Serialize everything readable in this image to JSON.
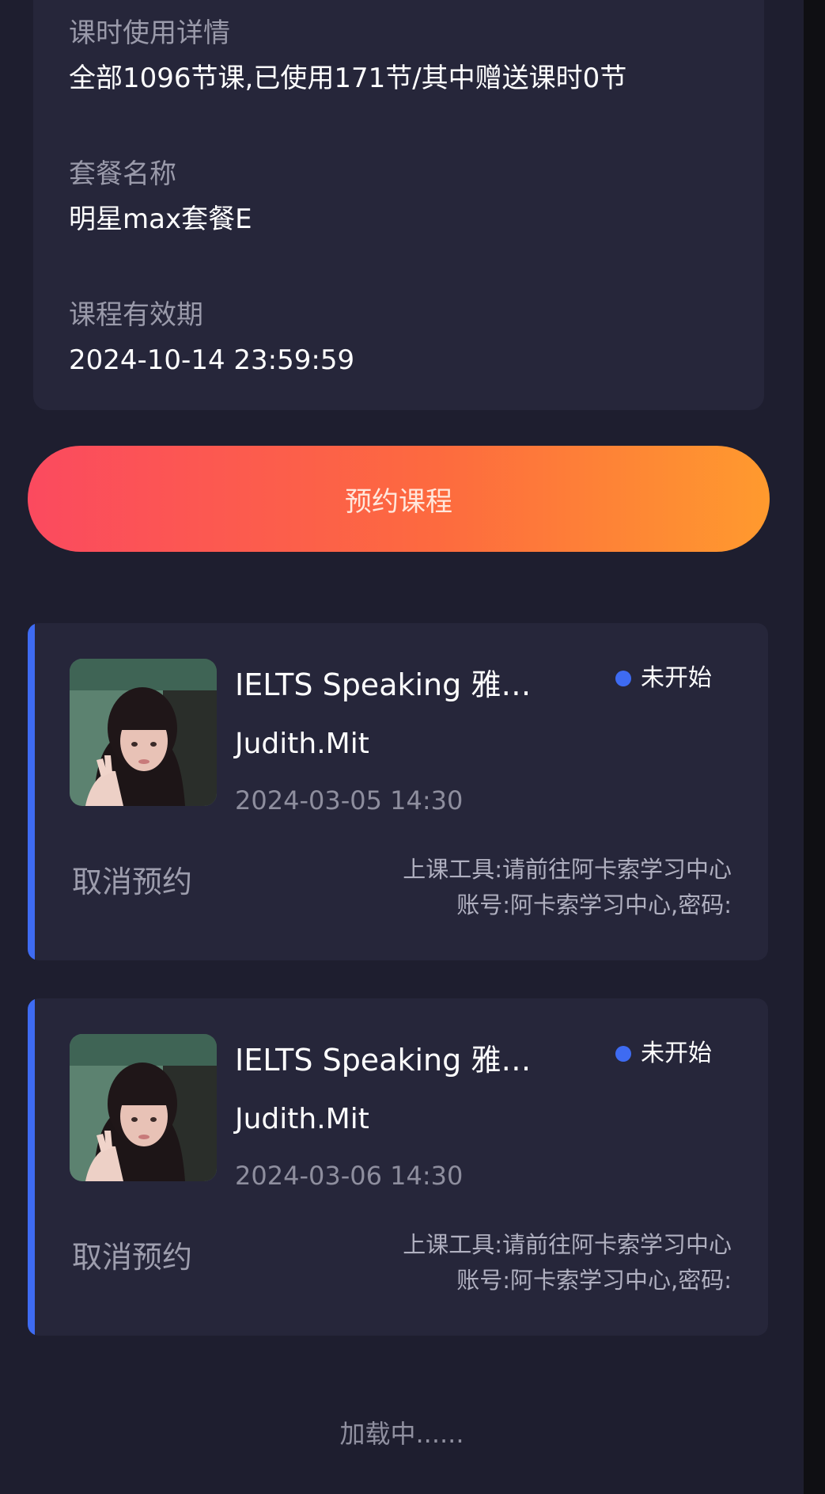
{
  "info": {
    "usage_label": "课时使用详情",
    "usage_value": "全部1096节课,已使用171节/其中赠送课时0节",
    "package_label": "套餐名称",
    "package_value": "明星max套餐E",
    "validity_label": "课程有效期",
    "validity_value": "2024-10-14 23:59:59"
  },
  "book_button": "预约课程",
  "lessons": [
    {
      "title": "IELTS Speaking 雅…",
      "status": "未开始",
      "teacher": "Judith.Mit",
      "time": "2024-03-05 14:30",
      "cancel": "取消预约",
      "tool": "上课工具:请前往阿卡索学习中心",
      "account": "账号:阿卡索学习中心,密码:"
    },
    {
      "title": "IELTS Speaking 雅…",
      "status": "未开始",
      "teacher": "Judith.Mit",
      "time": "2024-03-06 14:30",
      "cancel": "取消预约",
      "tool": "上课工具:请前往阿卡索学习中心",
      "account": "账号:阿卡索学习中心,密码:"
    }
  ],
  "loading_text": "加载中......",
  "colors": {
    "background": "#1e1e2f",
    "card": "#26263a",
    "accent_blue": "#3e6bf2",
    "button_gradient_start": "#fb4a5f",
    "button_gradient_end": "#ff9a2e"
  },
  "icons": {
    "status_dot": "blue-dot-icon",
    "avatar": "teacher-avatar"
  }
}
